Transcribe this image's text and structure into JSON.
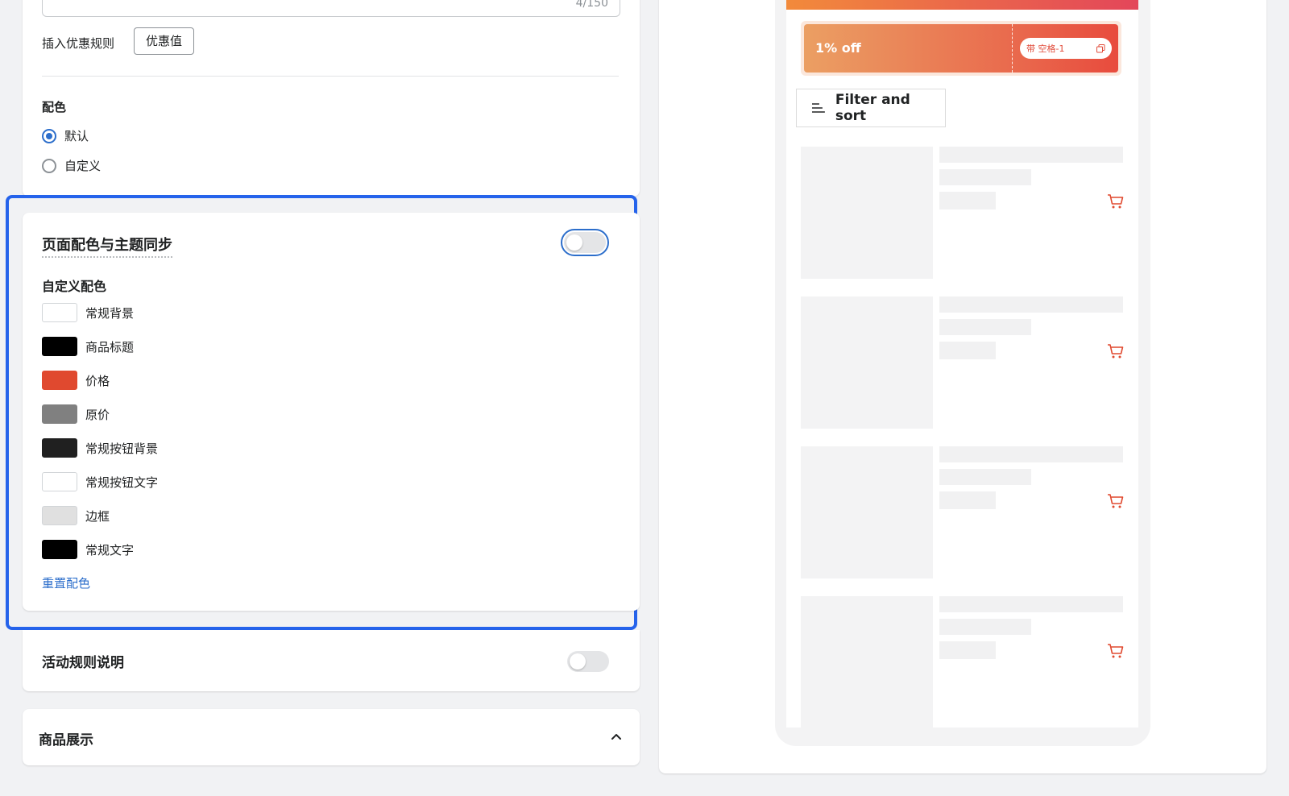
{
  "top_card": {
    "char_count": "4/150",
    "insert_rule_label": "插入优惠规则",
    "insert_rule_button": "优惠值",
    "color_section_title": "配色",
    "color_options": [
      {
        "label": "默认",
        "checked": true
      },
      {
        "label": "自定义",
        "checked": false
      }
    ]
  },
  "colors_card": {
    "sync_title": "页面配色与主题同步",
    "sync_enabled": false,
    "custom_title": "自定义配色",
    "swatches": [
      {
        "label": "常规背景",
        "color": "#ffffff"
      },
      {
        "label": "商品标题",
        "color": "#000000"
      },
      {
        "label": "价格",
        "color": "#e0492f"
      },
      {
        "label": "原价",
        "color": "#808080"
      },
      {
        "label": "常规按钮背景",
        "color": "#202020"
      },
      {
        "label": "常规按钮文字",
        "color": "#ffffff"
      },
      {
        "label": "边框",
        "color": "#e0e0e0"
      },
      {
        "label": "常规文字",
        "color": "#000000"
      }
    ],
    "reset_label": "重置配色"
  },
  "rules_card": {
    "title": "活动规则说明",
    "enabled": false
  },
  "display_card": {
    "title": "商品展示"
  },
  "preview": {
    "coupon_text": "1% off",
    "coupon_pill": "带 空格-1",
    "filter_label": "Filter and sort",
    "product_count": 4
  }
}
